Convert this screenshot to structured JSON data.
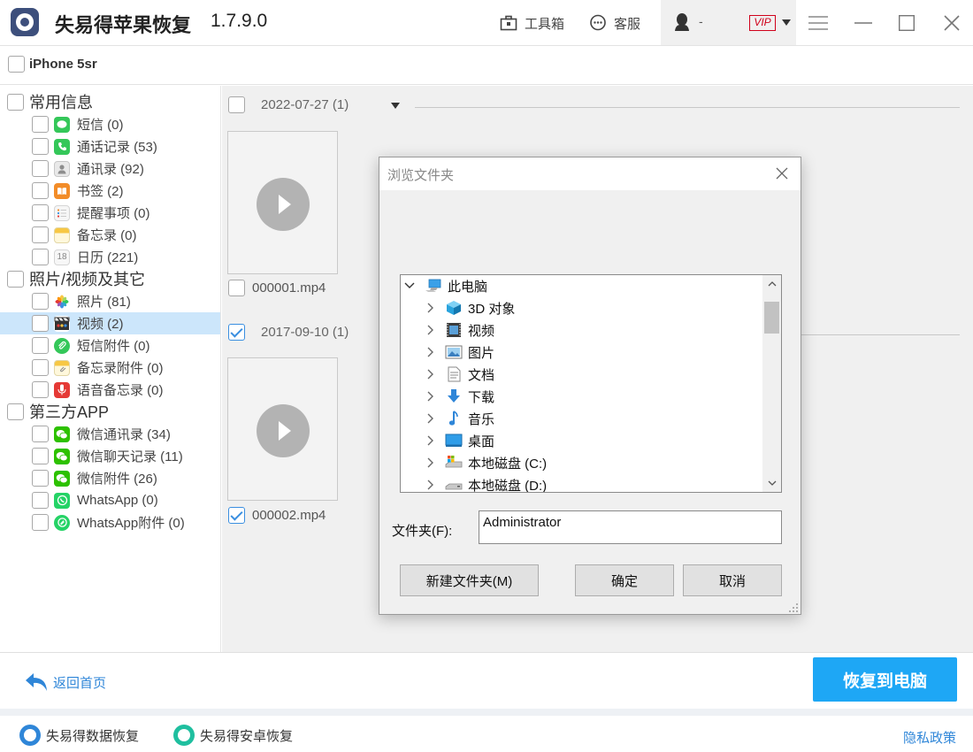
{
  "app": {
    "title": "失易得苹果恢复",
    "version": "1.7.9.0",
    "toolbox_label": "工具箱",
    "support_label": "客服",
    "user_name": "-",
    "vip_label": "VIP"
  },
  "device": {
    "name": "iPhone 5sr"
  },
  "sidebar": {
    "categories": [
      {
        "label": "常用信息"
      },
      {
        "label": "照片/视频及其它"
      },
      {
        "label": "第三方APP"
      }
    ],
    "items": [
      {
        "label": "短信 (0)",
        "icon": "message-icon",
        "color": "#34c759"
      },
      {
        "label": "通话记录 (53)",
        "icon": "phone-icon",
        "color": "#34c759"
      },
      {
        "label": "通讯录 (92)",
        "icon": "contacts-icon",
        "color": "#9e9e9e"
      },
      {
        "label": "书签 (2)",
        "icon": "book-icon",
        "color": "#f28c28"
      },
      {
        "label": "提醒事项 (0)",
        "icon": "reminders-icon",
        "color": "#e8e8e8"
      },
      {
        "label": "备忘录 (0)",
        "icon": "notes-icon",
        "color": "#f7c744"
      },
      {
        "label": "日历 (221)",
        "icon": "calendar-icon",
        "color": "#eeeeee"
      },
      {
        "label": "照片 (81)",
        "icon": "photos-icon",
        "color": "#ff9500"
      },
      {
        "label": "视频 (2)",
        "icon": "video-icon",
        "color": "#333333"
      },
      {
        "label": "短信附件 (0)",
        "icon": "attachment-icon",
        "color": "#34c759"
      },
      {
        "label": "备忘录附件 (0)",
        "icon": "notes-attachment-icon",
        "color": "#f7c744"
      },
      {
        "label": "语音备忘录 (0)",
        "icon": "microphone-icon",
        "color": "#e53935"
      },
      {
        "label": "微信通讯录 (34)",
        "icon": "wechat-icon",
        "color": "#2dc100"
      },
      {
        "label": "微信聊天记录 (11)",
        "icon": "wechat-icon",
        "color": "#2dc100"
      },
      {
        "label": "微信附件 (26)",
        "icon": "wechat-icon",
        "color": "#2dc100"
      },
      {
        "label": "WhatsApp (0)",
        "icon": "whatsapp-icon",
        "color": "#25d366"
      },
      {
        "label": "WhatsApp附件 (0)",
        "icon": "whatsapp-icon",
        "color": "#25d366"
      }
    ]
  },
  "content": {
    "groups": [
      {
        "date": "2022-07-27 (1)",
        "checked": false,
        "file": "000001.mp4",
        "file_checked": false
      },
      {
        "date": "2017-09-10 (1)",
        "checked": true,
        "file": "000002.mp4",
        "file_checked": true
      }
    ]
  },
  "dialog": {
    "title": "浏览文件夹",
    "tree": [
      {
        "label": "此电脑",
        "icon": "computer-icon"
      },
      {
        "label": "3D 对象",
        "icon": "3d-objects-icon"
      },
      {
        "label": "视频",
        "icon": "videos-folder-icon"
      },
      {
        "label": "图片",
        "icon": "pictures-folder-icon"
      },
      {
        "label": "文档",
        "icon": "documents-folder-icon"
      },
      {
        "label": "下载",
        "icon": "downloads-folder-icon"
      },
      {
        "label": "音乐",
        "icon": "music-folder-icon"
      },
      {
        "label": "桌面",
        "icon": "desktop-folder-icon"
      },
      {
        "label": "本地磁盘 (C:)",
        "icon": "drive-c-icon"
      },
      {
        "label": "本地磁盘 (D:)",
        "icon": "drive-d-icon"
      }
    ],
    "folder_label": "文件夹(F):",
    "folder_value": "Administrator",
    "new_folder_label": "新建文件夹(M)",
    "ok_label": "确定",
    "cancel_label": "取消"
  },
  "footer": {
    "back_label": "返回首页",
    "recover_label": "恢复到电脑",
    "data_recovery_label": "失易得数据恢复",
    "android_recovery_label": "失易得安卓恢复",
    "privacy_label": "隐私政策"
  },
  "colors": {
    "accent": "#1ea7f5",
    "link": "#2f86d8",
    "selection": "#cce6fb",
    "vip": "#d0021b"
  }
}
